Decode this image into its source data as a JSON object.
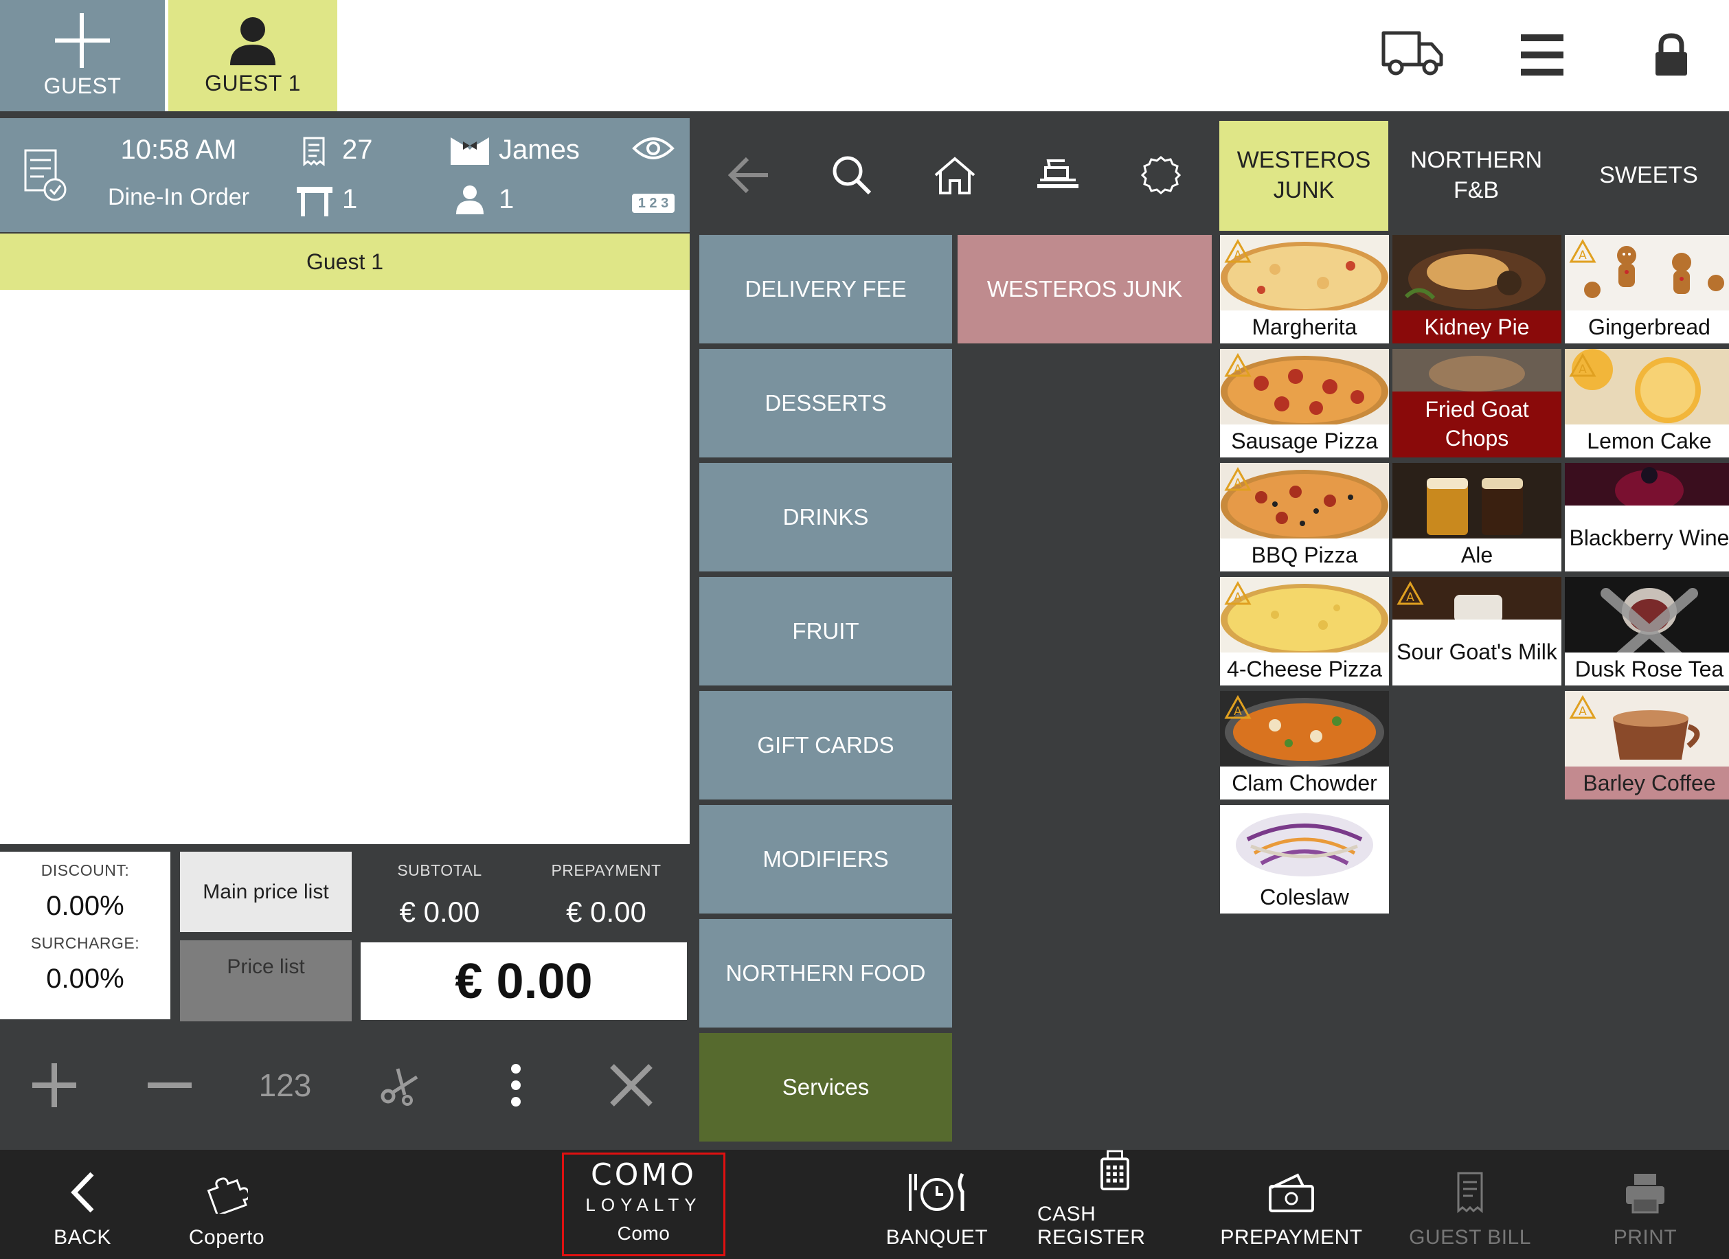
{
  "top_tabs": {
    "add_guest": "GUEST",
    "guest_1": "GUEST 1"
  },
  "order": {
    "time": "10:58 AM",
    "order_type": "Dine-In Order",
    "order_number": "27",
    "table": "1",
    "waiter": "James",
    "guests": "1",
    "view_mode": "1 2 3"
  },
  "guest_bar": "Guest 1",
  "totals": {
    "discount_label": "DISCOUNT:",
    "discount_value": "0.00%",
    "surcharge_label": "SURCHARGE:",
    "surcharge_value": "0.00%",
    "main_price_list": "Main price list",
    "price_list": "Price list",
    "subtotal_label": "SUBTOTAL",
    "subtotal_value": "€ 0.00",
    "prepayment_label": "PREPAYMENT",
    "prepayment_value": "€ 0.00",
    "grand_total": "€ 0.00"
  },
  "actions": {
    "quantity": "123"
  },
  "category_tabs": [
    {
      "label": "WESTEROS JUNK",
      "active": true
    },
    {
      "label": "NORTHERN F&B",
      "active": false
    },
    {
      "label": "SWEETS",
      "active": false
    }
  ],
  "categories": [
    {
      "label": "DELIVERY FEE"
    },
    {
      "label": "DESSERTS"
    },
    {
      "label": "DRINKS"
    },
    {
      "label": "FRUIT"
    },
    {
      "label": "GIFT CARDS"
    },
    {
      "label": "MODIFIERS"
    },
    {
      "label": "NORTHERN FOOD"
    },
    {
      "label": "Services"
    }
  ],
  "subcategory": "WESTEROS JUNK",
  "products": {
    "col1": [
      "Margherita",
      "Sausage Pizza",
      "BBQ Pizza",
      "4-Cheese Pizza",
      "Clam Chowder",
      "Coleslaw"
    ],
    "col2": [
      "Kidney Pie",
      "Fried Goat Chops",
      "Ale",
      "Sour Goat's Milk"
    ],
    "col3": [
      "Gingerbread",
      "Lemon Cake",
      "Blackberry Wine",
      "Dusk Rose Tea",
      "Barley Coffee"
    ]
  },
  "bottom_bar": {
    "back": "BACK",
    "coperto": "Coperto",
    "como_logo_top": "COMO",
    "como_logo_bottom": "LOYALTY",
    "como": "Como",
    "banquet": "BANQUET",
    "cash_register": "CASH REGISTER",
    "prepayment": "PREPAYMENT",
    "guest_bill": "GUEST BILL",
    "print": "PRINT"
  },
  "colors": {
    "slate": "#7a929e",
    "lime": "#dfe687",
    "panel": "#3b3d3e",
    "services_green": "#566a2e",
    "unavailable_red": "#8a0a0a",
    "highlight_pink": "#bf8b8e"
  }
}
